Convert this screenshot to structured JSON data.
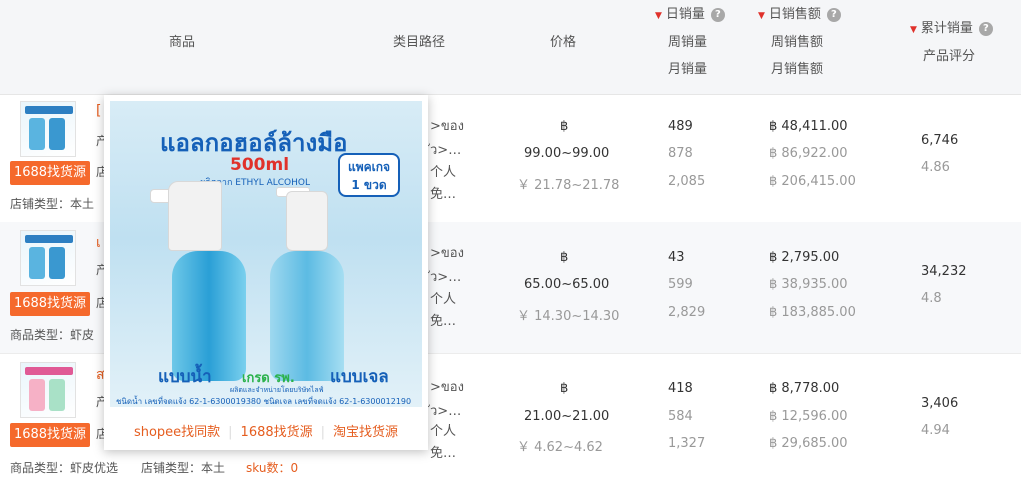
{
  "header": {
    "product": "商品",
    "category_path": "类目路径",
    "price": "价格",
    "daily_sales": "日销量",
    "weekly_sales": "周销量",
    "monthly_sales": "月销量",
    "daily_revenue": "日销售额",
    "weekly_revenue": "周销售额",
    "monthly_revenue": "月销售额",
    "total_sales": "累计销量",
    "rating": "产品评分",
    "help_glyph": "?",
    "sort_glyph": "▼"
  },
  "rows": [
    {
      "title_fragment": "[",
      "attr_fragment": "产",
      "shop_fragment": "店",
      "badge": "1688找货源",
      "footer": "店铺类型：本土",
      "category_lines": [
        ">ของ",
        "ัว>…",
        "个人",
        "免…"
      ],
      "price_currency": "฿",
      "price_thb": "99.00~99.00",
      "price_cny": "￥ 21.78~21.78",
      "daily_sales": "489",
      "weekly_sales": "878",
      "monthly_sales": "2,085",
      "daily_revenue": "฿ 48,411.00",
      "weekly_revenue": "฿ 86,922.00",
      "monthly_revenue": "฿ 206,415.00",
      "total_sales": "6,746",
      "rating": "4.86"
    },
    {
      "title_fragment": "เ",
      "attr_fragment": "产",
      "shop_fragment": "店",
      "badge": "1688找货源",
      "footer": "商品类型：虾皮",
      "category_lines": [
        ">ของ",
        "ัว>…",
        "个人",
        "免…"
      ],
      "price_currency": "฿",
      "price_thb": "65.00~65.00",
      "price_cny": "￥ 14.30~14.30",
      "daily_sales": "43",
      "weekly_sales": "599",
      "monthly_sales": "2,829",
      "daily_revenue": "฿ 2,795.00",
      "weekly_revenue": "฿ 38,935.00",
      "monthly_revenue": "฿ 183,885.00",
      "total_sales": "34,232",
      "rating": "4.8"
    },
    {
      "title_fragment": "ส",
      "attr_fragment": "产",
      "shop_fragment": "店",
      "badge": "1688找货源",
      "footer_type": "商品类型：虾皮优选",
      "footer_shop": "店铺类型：本土",
      "footer_sku": "sku数：0",
      "category_lines": [
        ">ของ",
        "ัว>…",
        "个人",
        "免…"
      ],
      "price_currency": "฿",
      "price_thb": "21.00~21.00",
      "price_cny": "￥ 4.62~4.62",
      "daily_sales": "418",
      "weekly_sales": "584",
      "monthly_sales": "1,327",
      "daily_revenue": "฿ 8,778.00",
      "weekly_revenue": "฿ 12,596.00",
      "monthly_revenue": "฿ 29,685.00",
      "total_sales": "3,406",
      "rating": "4.94"
    }
  ],
  "popup": {
    "image": {
      "title": "แอลกอฮอล์ล้างมือ",
      "volume": "500ml",
      "subtitle": "ผลิตจาก ETHYL ALCOHOL",
      "pack_line1": "แพคเกจ",
      "pack_line2": "1 ขวด",
      "label_left": "แบบน้ำ",
      "label_mid": "เกรด รพ.",
      "label_right": "แบบเจล",
      "maker": "ผลิตและจำหน่ายโดยบริษัทไลฟ์",
      "reg_numbers": "ชนิดน้ำ เลขที่จดแจ้ง 62-1-6300019380  ชนิดเจล เลขที่จดแจ้ง 62-1-6300012190"
    },
    "links": [
      "shopee找同款",
      "1688找货源",
      "淘宝找货源"
    ]
  },
  "colors": {
    "accent_orange": "#f5692c",
    "link_orange": "#e55d1f",
    "sort_red": "#e0312b",
    "header_bg": "#f5f6f8",
    "alt_row_bg": "#f7f8fa"
  }
}
